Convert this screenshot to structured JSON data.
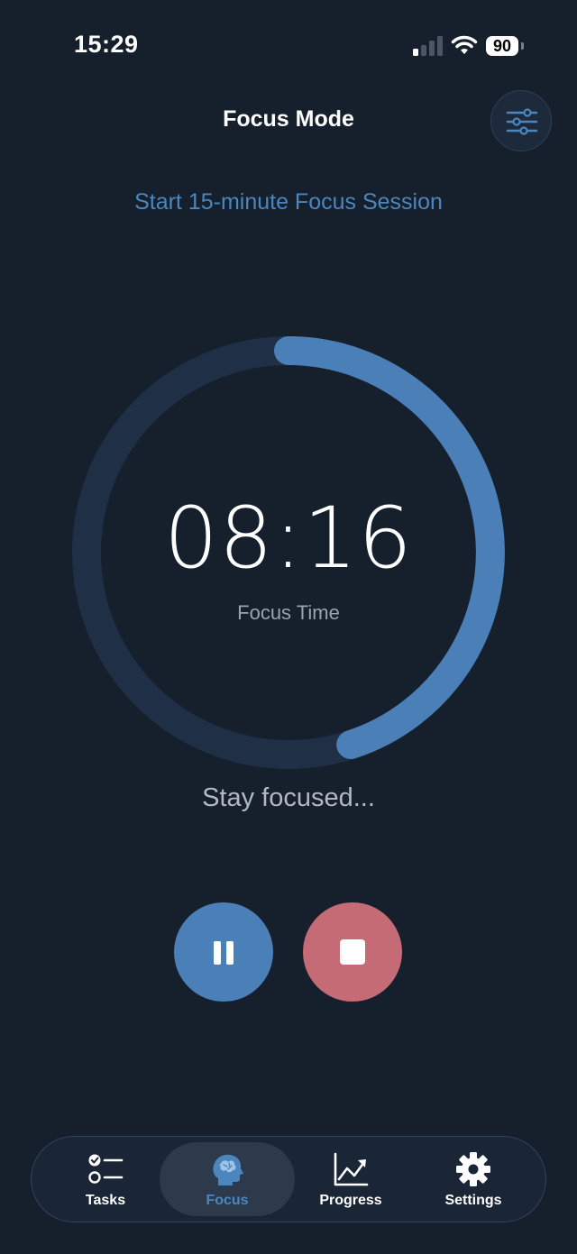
{
  "status_bar": {
    "time": "15:29",
    "battery": "90"
  },
  "header": {
    "title": "Focus Mode",
    "settings_icon": "sliders-icon"
  },
  "session": {
    "link_label": "Start 15-minute Focus Session"
  },
  "timer": {
    "display": "08:16",
    "label": "Focus Time",
    "progress_fraction": 0.45
  },
  "motivation": "Stay focused...",
  "controls": {
    "pause_icon": "pause-icon",
    "stop_icon": "stop-icon"
  },
  "tabs": [
    {
      "label": "Tasks",
      "icon": "checklist-icon",
      "active": false
    },
    {
      "label": "Focus",
      "icon": "brain-icon",
      "active": true
    },
    {
      "label": "Progress",
      "icon": "chart-icon",
      "active": false
    },
    {
      "label": "Settings",
      "icon": "gear-icon",
      "active": false
    }
  ],
  "colors": {
    "background": "#161f2c",
    "accent": "#4a7fb8",
    "stop": "#c56b76",
    "ring_track": "#1f3046"
  }
}
